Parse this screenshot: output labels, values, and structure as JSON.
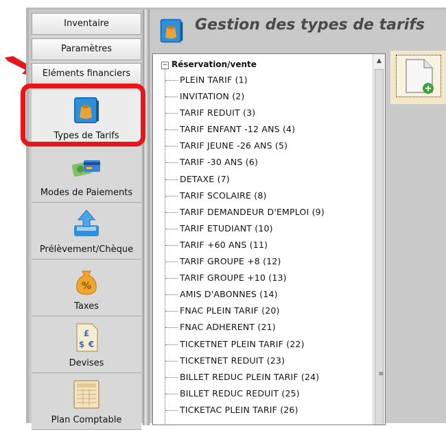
{
  "sidebar": {
    "top_buttons": [
      {
        "label": "Inventaire"
      },
      {
        "label": "Paramètres"
      },
      {
        "label": "Eléments financiers"
      }
    ],
    "items": [
      {
        "label": "Types de Tarifs",
        "icon": "tarif-bag-icon",
        "active": true
      },
      {
        "label": "Modes de Paiements",
        "icon": "payment-cards-icon"
      },
      {
        "label": "Prélèvement/Chèque",
        "icon": "upload-tray-icon"
      },
      {
        "label": "Taxes",
        "icon": "percent-bag-icon"
      },
      {
        "label": "Devises",
        "icon": "currency-document-icon"
      },
      {
        "label": "Plan Comptable",
        "icon": "ledger-icon"
      }
    ]
  },
  "header": {
    "title": "Gestion des types de tarifs",
    "icon": "tarif-bag-icon"
  },
  "tree": {
    "root_label": "Réservation/vente",
    "root_toggle": "−",
    "items": [
      "PLEIN TARIF (1)",
      "INVITATION (2)",
      "TARIF REDUIT (3)",
      "TARIF ENFANT -12 ANS (4)",
      "TARIF JEUNE -26 ANS (5)",
      "TARIF -30 ANS (6)",
      "DETAXE (7)",
      "TARIF SCOLAIRE (8)",
      "TARIF DEMANDEUR D'EMPLOI (9)",
      "TARIF ETUDIANT (10)",
      "TARIF +60 ANS (11)",
      "TARIF GROUPE +8 (12)",
      "TARIF GROUPE +10 (13)",
      "AMIS D'ABONNES (14)",
      "FNAC PLEIN TARIF (20)",
      "FNAC ADHERENT (21)",
      "TICKETNET PLEIN TARIF (22)",
      "TICKETNET REDUIT (23)",
      "BILLET REDUC PLEIN TARIF (24)",
      "BILLET REDUC REDUIT (25)",
      "TICKETAC PLEIN TARIF (26)"
    ]
  },
  "toolbar": {
    "new_icon": "new-document-icon"
  },
  "annotations": {
    "highlight_color": "#e8151b",
    "arrow_color": "#e8151b"
  }
}
